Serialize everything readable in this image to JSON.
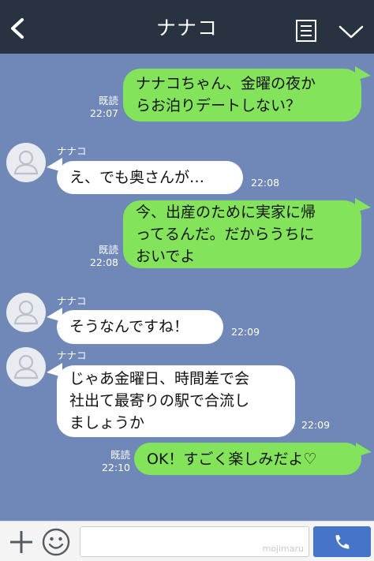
{
  "header": {
    "title": "ナナコ",
    "back_icon": "chevron-left-icon",
    "menu_icon": "notes-icon",
    "expand_icon": "chevron-down-icon"
  },
  "colors": {
    "header_bg": "#283241",
    "chat_bg": "#6f88b7",
    "outgoing_bubble": "#83e35a",
    "incoming_bubble": "#ffffff",
    "call_button": "#4674c8"
  },
  "messages": [
    {
      "direction": "outgoing",
      "lines": [
        "ナナコちゃん、金曜の夜か",
        "らお泊りデートしない？"
      ],
      "read": "既読",
      "time": "22:07"
    },
    {
      "direction": "incoming",
      "sender": "ナナコ",
      "lines": [
        "え、でも奥さんが…"
      ],
      "time": "22:08"
    },
    {
      "direction": "outgoing",
      "lines": [
        "今、出産のために実家に帰",
        "ってるんだ。だからうちに",
        "おいでよ"
      ],
      "read": "既読",
      "time": "22:08"
    },
    {
      "direction": "incoming",
      "sender": "ナナコ",
      "lines": [
        "そうなんですね！"
      ],
      "time": "22:09"
    },
    {
      "direction": "incoming",
      "sender": "ナナコ",
      "lines": [
        "じゃあ金曜日、時間差で会",
        "社出て最寄りの駅で合流し",
        "ましょうか"
      ],
      "time": "22:09"
    },
    {
      "direction": "outgoing",
      "lines": [
        "OK！すごく楽しみだよ♡"
      ],
      "read": "既読",
      "time": "22:10"
    }
  ],
  "footer": {
    "plus_icon": "plus-icon",
    "sticker_icon": "smiley-icon",
    "input_value": "",
    "watermark": "mojimaru",
    "call_icon": "phone-icon"
  }
}
